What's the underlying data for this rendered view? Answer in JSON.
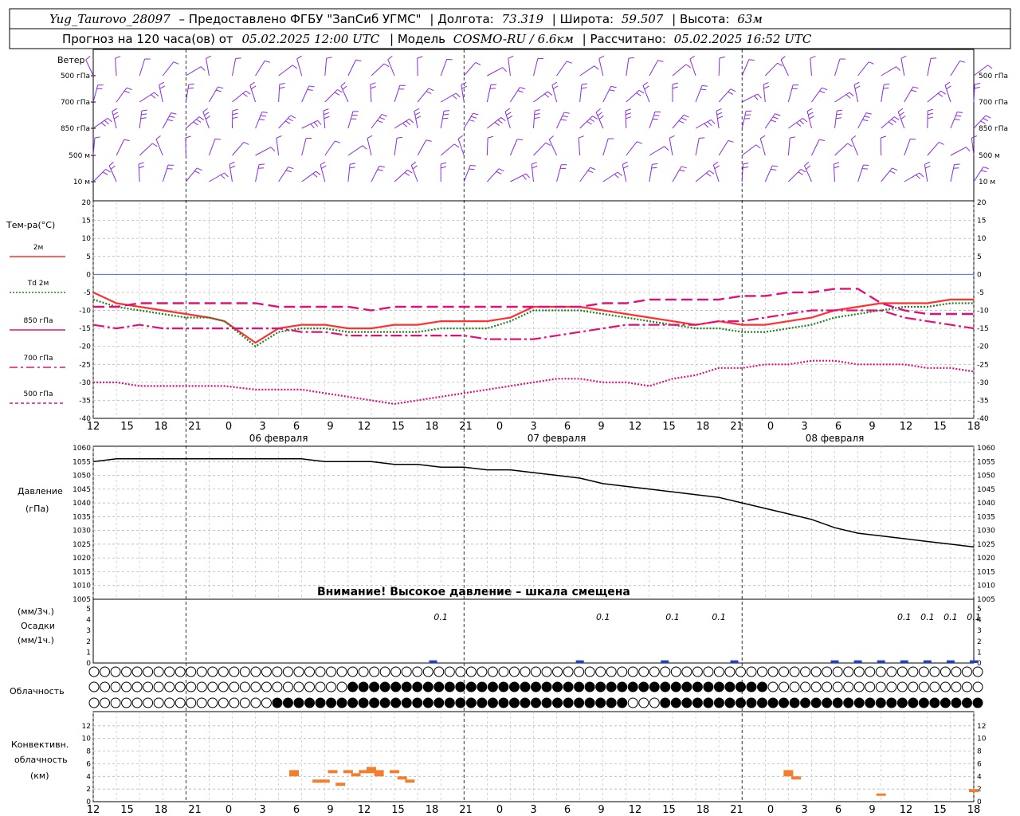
{
  "header": {
    "station": "Yug_Taurovo_28097",
    "provided_by": "– Предоставлено ФГБУ \"ЗапСиб УГМС\"",
    "lon_label": "| Долгота:",
    "lon": "73.319",
    "lat_label": "| Широта:",
    "lat": "59.507",
    "alt_label": "| Высота:",
    "alt": "63м",
    "forecast": "Прогноз на 120 часа(ов) от",
    "forecast_start": "05.02.2025 12:00 UTC",
    "model_label": "| Модель",
    "model": "COSMO-RU / 6.6км",
    "computed_label": "| Рассчитано:",
    "computed": "05.02.2025 16:52 UTC"
  },
  "wind_panel": {
    "title": "Ветер",
    "levels": [
      "500 гПа",
      "700 гПа",
      "850 гПа",
      "500 м",
      "10  м"
    ]
  },
  "temp_panel": {
    "title": "Тем-ра(°C)",
    "legend": [
      {
        "label": "2м",
        "color": "#ff3030",
        "dash": ""
      },
      {
        "label": "Td  2м",
        "color": "#208020",
        "dash": "2,2"
      },
      {
        "label": "850 гПа",
        "color": "#e0107a",
        "dash": ""
      },
      {
        "label": "700 гПа",
        "color": "#e0107a",
        "dash": "10,4,3,4"
      },
      {
        "label": "500 гПа",
        "color": "#e0107a",
        "dash": "4,3"
      }
    ]
  },
  "pressure_panel": {
    "title_1": "Давление",
    "title_2": "(гПа)",
    "warning": "Внимание! Высокое давление – шкала смещена"
  },
  "precip_panel": {
    "title_1": "(мм/3ч.)",
    "title_2": "Осадки",
    "title_3": "(мм/1ч.)"
  },
  "cloud_panel": {
    "title": "Облачность"
  },
  "conv_panel": {
    "title_1": "Конвективн.",
    "title_2": "облачность",
    "title_3": "(км)"
  },
  "x_axis": {
    "hour_labels": [
      "12",
      "15",
      "18",
      "21",
      "0",
      "3",
      "6",
      "9",
      "12",
      "15",
      "18",
      "21",
      "0",
      "3",
      "6",
      "9",
      "12",
      "15",
      "18",
      "21",
      "0",
      "3",
      "6",
      "9",
      "12",
      "15",
      "18"
    ],
    "days": [
      "06 февраля",
      "07 февраля",
      "08 февраля"
    ]
  },
  "chart_data": [
    {
      "type": "line",
      "title": "Тем-ра(°C)",
      "ylim": [
        -40,
        20
      ],
      "x_hours": [
        0,
        3,
        6,
        9,
        12,
        15,
        17,
        21,
        24,
        27,
        30,
        33,
        36,
        39,
        42,
        45,
        48,
        51,
        54,
        57,
        60,
        63,
        66,
        69,
        72,
        75,
        78,
        81,
        84,
        87,
        90,
        93,
        96,
        99,
        102,
        105,
        108,
        111,
        114
      ],
      "series": [
        {
          "name": "2м",
          "values": [
            -5,
            -8,
            -9,
            -10,
            -11,
            -12,
            -13,
            -19,
            -15,
            -14,
            -14,
            -15,
            -15,
            -14,
            -14,
            -13,
            -13,
            -13,
            -12,
            -9,
            -9,
            -9,
            -10,
            -11,
            -12,
            -13,
            -14,
            -13,
            -14,
            -14,
            -13,
            -12,
            -10,
            -9,
            -8,
            -8,
            -8,
            -7,
            -7
          ]
        },
        {
          "name": "Td  2м",
          "values": [
            -7,
            -9,
            -10,
            -11,
            -12,
            -12,
            -13,
            -20,
            -16,
            -15,
            -15,
            -16,
            -16,
            -16,
            -16,
            -15,
            -15,
            -15,
            -13,
            -10,
            -10,
            -10,
            -11,
            -12,
            -13,
            -14,
            -15,
            -15,
            -16,
            -16,
            -15,
            -14,
            -12,
            -11,
            -10,
            -9,
            -9,
            -8,
            -8
          ]
        },
        {
          "name": "850 гПа",
          "values": [
            -9,
            -9,
            -8,
            -8,
            -8,
            -8,
            -8,
            -8,
            -9,
            -9,
            -9,
            -9,
            -10,
            -9,
            -9,
            -9,
            -9,
            -9,
            -9,
            -9,
            -9,
            -9,
            -8,
            -8,
            -7,
            -7,
            -7,
            -7,
            -6,
            -6,
            -5,
            -5,
            -4,
            -4,
            -8,
            -10,
            -11,
            -11,
            -11
          ]
        },
        {
          "name": "700 гПа",
          "values": [
            -14,
            -15,
            -14,
            -15,
            -15,
            -15,
            -15,
            -15,
            -15,
            -16,
            -16,
            -17,
            -17,
            -17,
            -17,
            -17,
            -17,
            -18,
            -18,
            -18,
            -17,
            -16,
            -15,
            -14,
            -14,
            -14,
            -14,
            -13,
            -13,
            -12,
            -11,
            -10,
            -10,
            -10,
            -10,
            -12,
            -13,
            -14,
            -15
          ]
        },
        {
          "name": "500 гПа",
          "values": [
            -30,
            -30,
            -31,
            -31,
            -31,
            -31,
            -31,
            -32,
            -32,
            -32,
            -33,
            -34,
            -35,
            -36,
            -35,
            -34,
            -33,
            -32,
            -31,
            -30,
            -29,
            -29,
            -30,
            -30,
            -31,
            -29,
            -28,
            -26,
            -26,
            -25,
            -25,
            -24,
            -24,
            -25,
            -25,
            -25,
            -26,
            -26,
            -27
          ]
        }
      ]
    },
    {
      "type": "line",
      "title": "Давление (гПа)",
      "ylim": [
        1005,
        1060
      ],
      "x_hours": [
        0,
        3,
        6,
        9,
        12,
        15,
        18,
        21,
        24,
        27,
        30,
        33,
        36,
        39,
        42,
        45,
        48,
        51,
        54,
        57,
        60,
        63,
        66,
        69,
        72,
        75,
        78,
        81,
        84,
        87,
        90,
        93,
        96,
        99,
        102,
        105,
        108,
        111,
        114
      ],
      "values": [
        1055,
        1056,
        1056,
        1056,
        1056,
        1056,
        1056,
        1056,
        1056,
        1056,
        1055,
        1055,
        1055,
        1054,
        1054,
        1053,
        1053,
        1052,
        1052,
        1051,
        1050,
        1049,
        1047,
        1046,
        1045,
        1044,
        1043,
        1042,
        1040,
        1038,
        1036,
        1034,
        1031,
        1029,
        1028,
        1027,
        1026,
        1025,
        1024
      ]
    },
    {
      "type": "bar",
      "title": "Осадки (мм/1ч.)",
      "ylim": [
        0,
        5
      ],
      "x_hours": [
        44,
        63,
        74,
        83,
        96,
        99,
        102,
        105,
        108,
        111,
        114
      ],
      "values": [
        0.1,
        0.1,
        0.1,
        0.1,
        0.1,
        0.1,
        0.1,
        0.1,
        0.1,
        0.1,
        0.1
      ],
      "data_labels": [
        {
          "x_hour": 45,
          "text": "0.1"
        },
        {
          "x_hour": 66,
          "text": "0.1"
        },
        {
          "x_hour": 75,
          "text": "0.1"
        },
        {
          "x_hour": 81,
          "text": "0.1"
        },
        {
          "x_hour": 105,
          "text": "0.1"
        },
        {
          "x_hour": 108,
          "text": "0.1"
        },
        {
          "x_hour": 111,
          "text": "0.1"
        },
        {
          "x_hour": 114,
          "text": "0.1"
        }
      ]
    },
    {
      "type": "bar",
      "title": "Конвективн. облачность (км)",
      "ylim": [
        0,
        14
      ],
      "bars": [
        {
          "x_hour": 26,
          "low": 4,
          "high": 5
        },
        {
          "x_hour": 29,
          "low": 3,
          "high": 3.5
        },
        {
          "x_hour": 30,
          "low": 3,
          "high": 3.5
        },
        {
          "x_hour": 31,
          "low": 4.5,
          "high": 5
        },
        {
          "x_hour": 32,
          "low": 2.5,
          "high": 3
        },
        {
          "x_hour": 33,
          "low": 4.5,
          "high": 5
        },
        {
          "x_hour": 34,
          "low": 4,
          "high": 4.5
        },
        {
          "x_hour": 35,
          "low": 4.5,
          "high": 5
        },
        {
          "x_hour": 36,
          "low": 4.5,
          "high": 5.5
        },
        {
          "x_hour": 37,
          "low": 4,
          "high": 5
        },
        {
          "x_hour": 39,
          "low": 4.5,
          "high": 5
        },
        {
          "x_hour": 40,
          "low": 3.5,
          "high": 4
        },
        {
          "x_hour": 41,
          "low": 3,
          "high": 3.5
        },
        {
          "x_hour": 90,
          "low": 4,
          "high": 5
        },
        {
          "x_hour": 91,
          "low": 3.5,
          "high": 4
        },
        {
          "x_hour": 102,
          "low": 1,
          "high": 1.3
        },
        {
          "x_hour": 114,
          "low": 1.5,
          "high": 2
        }
      ]
    }
  ],
  "colors": {
    "wind": "#8a2be2",
    "t2m": "#ff3030",
    "td": "#208020",
    "upper": "#e0107a",
    "zero_line": "#3050ff",
    "precip": "#2040c0",
    "convective": "#f08030"
  }
}
